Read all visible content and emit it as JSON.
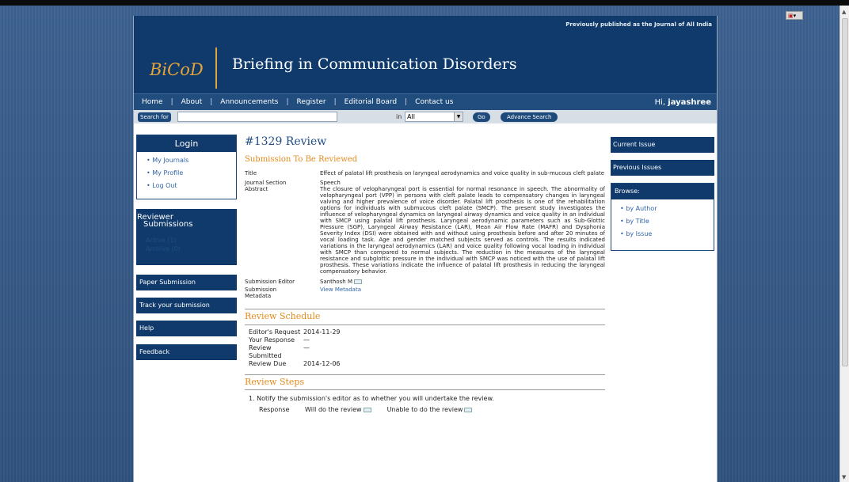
{
  "header": {
    "prev_published": "Previously published as the Journal of All India",
    "logo": "BiCoD",
    "title": "Briefing in Communication Disorders"
  },
  "nav": {
    "items": [
      "Home",
      "About",
      "Announcements",
      "Register",
      "Editorial Board",
      "Contact us"
    ],
    "greeting_prefix": "Hi,",
    "username": "jayashree"
  },
  "search": {
    "label": "Search for",
    "value": "",
    "in_label": "in",
    "scope": "All",
    "go": "Go",
    "advanced": "Advance Search"
  },
  "login": {
    "title": "Login",
    "links": [
      "My Journals",
      "My Profile",
      "Log Out"
    ]
  },
  "reviewer": {
    "title_line1": "Reviewer",
    "title_line2": "Submissions",
    "items": [
      "Active (1)",
      "Archive (0)"
    ]
  },
  "sidebar_left": [
    "Paper Submission",
    "Track your submission",
    "Help",
    "Feedback"
  ],
  "sidebar_right": {
    "current_issue": "Current Issue",
    "previous_issues": "Previous Issues",
    "browse_title": "Browse:",
    "browse_links": [
      "by Author",
      "by Title",
      "by Issue"
    ]
  },
  "review": {
    "heading": "#1329 Review",
    "section_title": "Submission To Be Reviewed",
    "title_label": "Title",
    "title_value": "Effect of palatal lift prosthesis on laryngeal aerodynamics and voice quality in sub-mucous cleft palate",
    "section_label": "Journal Section",
    "section_value": "Speech",
    "abstract_label": "Abstract",
    "abstract_value": "The closure of velopharyngeal port is essential for normal resonance in speech. The abnormality of velopharyngeal port (VPP) in persons with cleft palate leads to compensatory changes in laryngeal valving and higher prevalence of voice disorder. Palatal lift prosthesis is one of the rehabilitation options for individuals with submucous cleft palate (SMCP). The present study investigates the influence of velopharyngeal dynamics on laryngeal airway dynamics and voice quality in an individual with SMCP using palatal lift prosthesis. Laryngeal aerodynamic parameters such as Sub-Glottic Pressure (SGP), Laryngeal Airway Resistance (LAR), Mean Air Flow Rate (MAFR) and Dysphonia Severity Index (DSI) were obtained with and without using prosthesis before and after 20 minutes of vocal loading task. Age and gender matched subjects served as controls. The results indicated variations in the laryngeal aerodynamics (LAR) and voice quality following vocal loading in individual with SMCP than compared to normal subjects. The reduction in the measures of the laryngeal resistance and subglottic pressure in the individual with SMCP was noticed with the use of palatal lift prosthesis. These variations indicate the influence of palatal lift prosthesis in reducing the laryngeal compensatory behavior.",
    "editor_label": "Submission Editor",
    "editor_value": "Santhosh M",
    "metadata_label_1": "Submission",
    "metadata_label_2": "Metadata",
    "metadata_link": "View Metadata"
  },
  "schedule": {
    "title": "Review Schedule",
    "rows": [
      {
        "label": "Editor's Request",
        "value": "2014-11-29"
      },
      {
        "label": "Your Response",
        "value": "—"
      },
      {
        "label": "Review Submitted",
        "value": "—"
      },
      {
        "label": "Review Due",
        "value": "2014-12-06"
      }
    ]
  },
  "steps": {
    "title": "Review Steps",
    "step1": "1.  Notify the submission's editor as to whether you will undertake the review.",
    "response_label": "Response",
    "will_do": "Will do the review",
    "unable": "Unable to do the review"
  }
}
